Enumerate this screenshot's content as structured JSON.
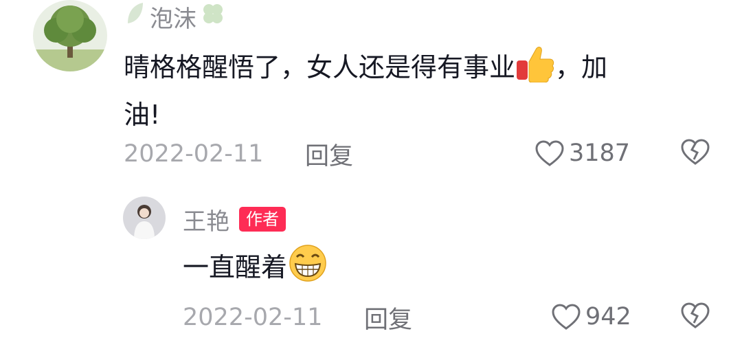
{
  "comment": {
    "username": "泡沫",
    "text_part1": "晴格格醒悟了，女人还是得有事业",
    "text_part2": "，加",
    "text_part3": "油!",
    "date": "2022-02-11",
    "reply_label": "回复",
    "like_count": "3187"
  },
  "reply": {
    "username": "王艳",
    "author_badge": "作者",
    "text": "一直醒着",
    "date": "2022-02-11",
    "reply_label": "回复",
    "like_count": "942"
  },
  "colors": {
    "badge": "#fe2c55",
    "username": "#8a8b91",
    "meta": "#a7a8ad",
    "text": "#161823"
  },
  "icons": [
    "leaf-icon",
    "clover-icon",
    "thumbs-up-emoji",
    "grin-emoji",
    "heart-icon",
    "broken-heart-icon"
  ]
}
